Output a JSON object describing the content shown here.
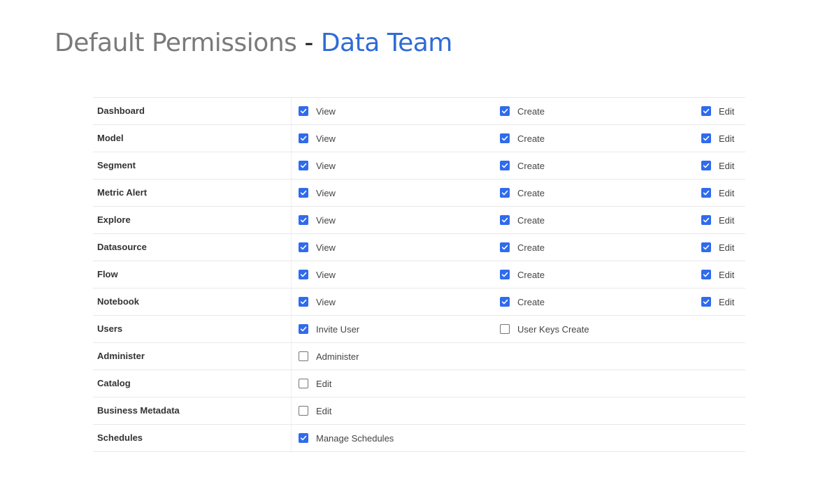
{
  "header": {
    "title_main": "Default Permissions",
    "title_separator": "-",
    "title_team": "Data Team"
  },
  "colors": {
    "accent": "#2f6bd6",
    "checkbox_checked": "#2f6bed",
    "title_gray": "#7a7a7a"
  },
  "permissions": [
    {
      "name": "Dashboard",
      "options": [
        {
          "label": "View",
          "checked": true
        },
        {
          "label": "Create",
          "checked": true
        },
        {
          "label": "Edit",
          "checked": true
        }
      ]
    },
    {
      "name": "Model",
      "options": [
        {
          "label": "View",
          "checked": true
        },
        {
          "label": "Create",
          "checked": true
        },
        {
          "label": "Edit",
          "checked": true
        }
      ]
    },
    {
      "name": "Segment",
      "options": [
        {
          "label": "View",
          "checked": true
        },
        {
          "label": "Create",
          "checked": true
        },
        {
          "label": "Edit",
          "checked": true
        }
      ]
    },
    {
      "name": "Metric Alert",
      "options": [
        {
          "label": "View",
          "checked": true
        },
        {
          "label": "Create",
          "checked": true
        },
        {
          "label": "Edit",
          "checked": true
        }
      ]
    },
    {
      "name": "Explore",
      "options": [
        {
          "label": "View",
          "checked": true
        },
        {
          "label": "Create",
          "checked": true
        },
        {
          "label": "Edit",
          "checked": true
        }
      ]
    },
    {
      "name": "Datasource",
      "options": [
        {
          "label": "View",
          "checked": true
        },
        {
          "label": "Create",
          "checked": true
        },
        {
          "label": "Edit",
          "checked": true
        }
      ]
    },
    {
      "name": "Flow",
      "options": [
        {
          "label": "View",
          "checked": true
        },
        {
          "label": "Create",
          "checked": true
        },
        {
          "label": "Edit",
          "checked": true
        }
      ]
    },
    {
      "name": "Notebook",
      "options": [
        {
          "label": "View",
          "checked": true
        },
        {
          "label": "Create",
          "checked": true
        },
        {
          "label": "Edit",
          "checked": true
        }
      ]
    },
    {
      "name": "Users",
      "options": [
        {
          "label": "Invite User",
          "checked": true
        },
        {
          "label": "User Keys Create",
          "checked": false
        }
      ]
    },
    {
      "name": "Administer",
      "options": [
        {
          "label": "Administer",
          "checked": false
        }
      ]
    },
    {
      "name": "Catalog",
      "options": [
        {
          "label": "Edit",
          "checked": false
        }
      ]
    },
    {
      "name": "Business Metadata",
      "options": [
        {
          "label": "Edit",
          "checked": false
        }
      ]
    },
    {
      "name": "Schedules",
      "options": [
        {
          "label": "Manage Schedules",
          "checked": true
        }
      ]
    }
  ]
}
